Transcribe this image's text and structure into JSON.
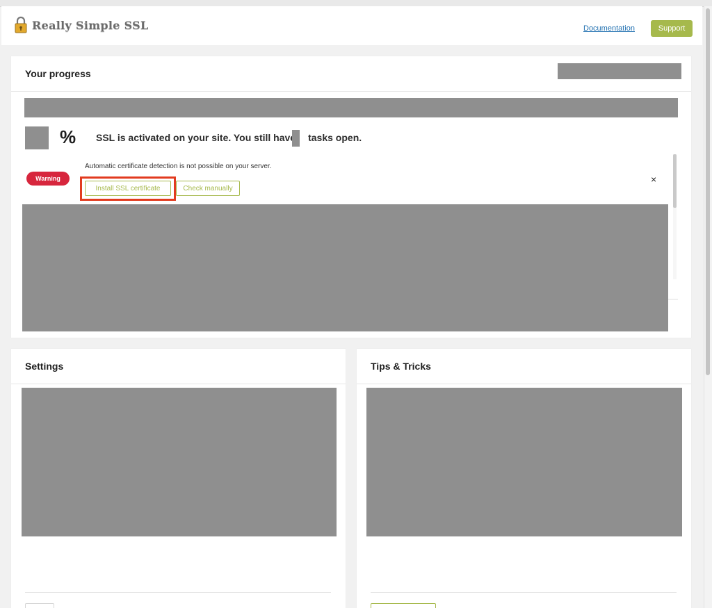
{
  "header": {
    "app_title": "Really Simple SSL",
    "documentation_label": "Documentation",
    "support_label": "Support"
  },
  "progress": {
    "title": "Your progress",
    "percent_symbol": "%",
    "status_before": "SSL is activated on your site. You still have",
    "status_after": "tasks open.",
    "task": {
      "badge": "Warning",
      "message": "Automatic certificate detection is not possible on your server.",
      "primary_action": "Install SSL certificate",
      "secondary_action": "Check manually",
      "close_glyph": "×"
    }
  },
  "settings": {
    "title": "Settings"
  },
  "tips": {
    "title": "Tips & Tricks"
  },
  "colors": {
    "accent": "#a6b94c",
    "warning": "#d7263d",
    "link": "#2271b1",
    "highlight": "#e23b1f",
    "redacted": "#8f8f8f"
  },
  "icons": {
    "logo": "padlock-icon",
    "close": "close-icon"
  }
}
